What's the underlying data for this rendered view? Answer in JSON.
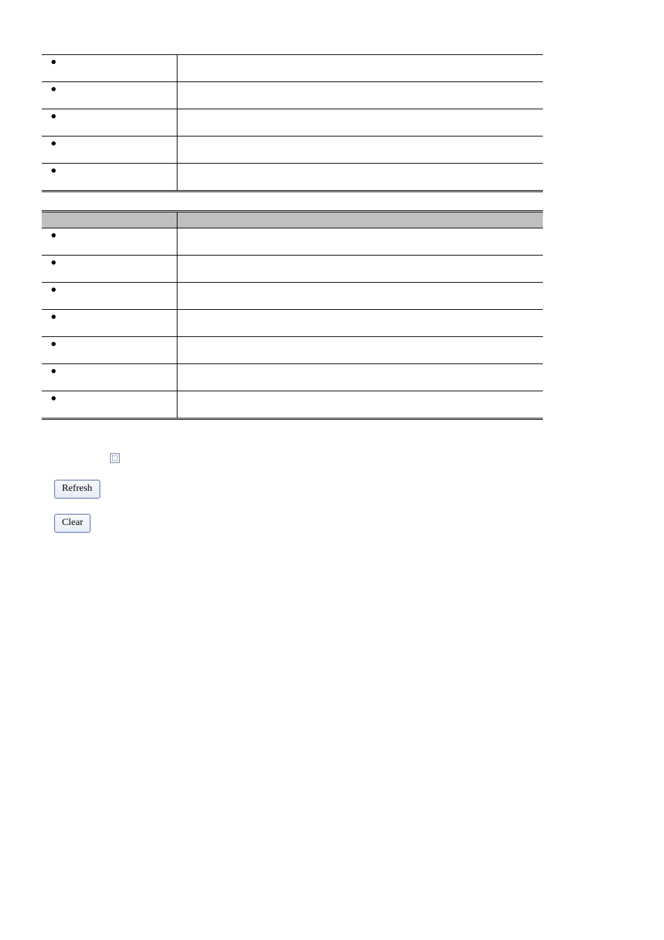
{
  "table1": {
    "rows": [
      {
        "left": "",
        "right": ""
      },
      {
        "left": "",
        "right": ""
      },
      {
        "left": "",
        "right": ""
      },
      {
        "left": "",
        "right": ""
      },
      {
        "left": "",
        "right": ""
      }
    ]
  },
  "table2": {
    "header_left": "",
    "header_right": "",
    "rows": [
      {
        "left": "",
        "right": ""
      },
      {
        "left": "",
        "right": ""
      },
      {
        "left": "",
        "right": ""
      },
      {
        "left": "",
        "right": ""
      },
      {
        "left": "",
        "right": ""
      },
      {
        "left": "",
        "right": ""
      },
      {
        "left": "",
        "right": ""
      }
    ]
  },
  "checkbox": {
    "label": "",
    "checked": false
  },
  "buttons": {
    "refresh": "Refresh",
    "clear": "Clear"
  }
}
